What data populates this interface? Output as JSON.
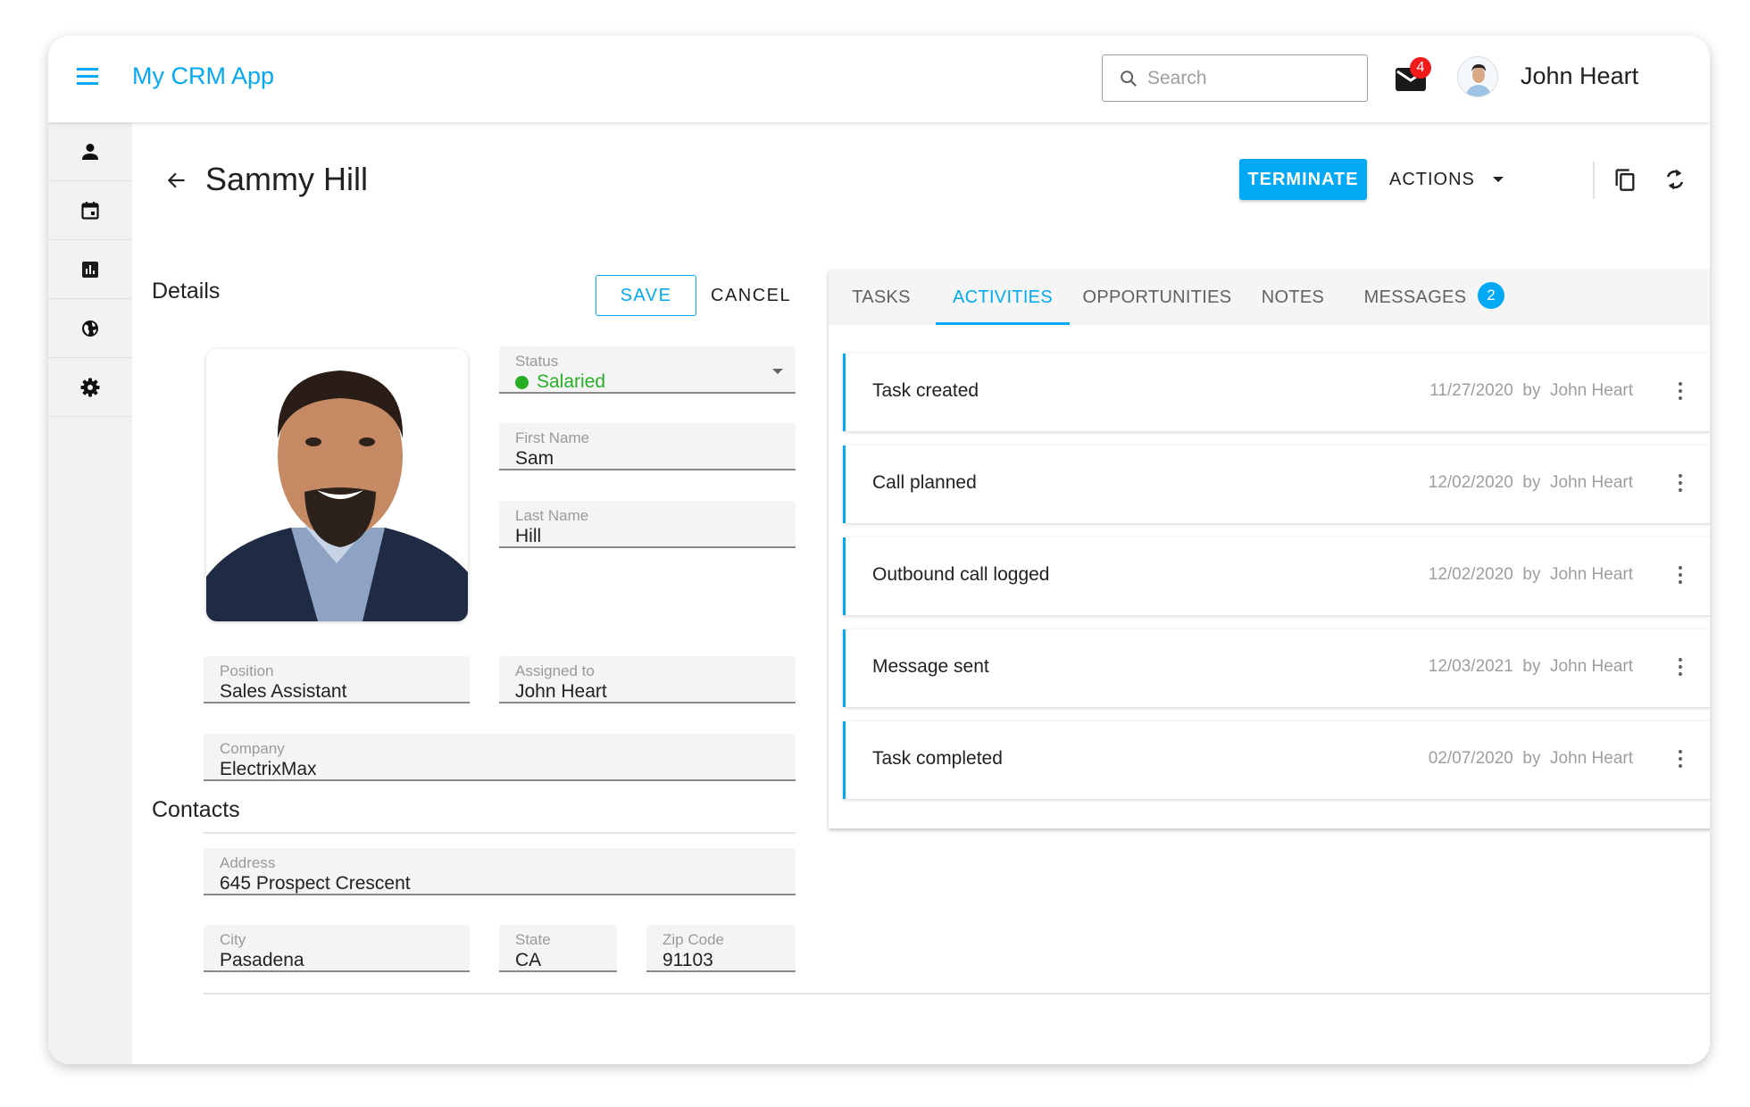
{
  "app": {
    "title": "My CRM App",
    "search_placeholder": "Search",
    "mail_badge_count": "4",
    "user_name": "John Heart",
    "accent_color": "#03a9f4"
  },
  "sidebar": {
    "items": [
      {
        "icon": "person-icon",
        "label": "Contacts"
      },
      {
        "icon": "calendar-icon",
        "label": "Calendar"
      },
      {
        "icon": "chart-icon",
        "label": "Analytics"
      },
      {
        "icon": "globe-icon",
        "label": "Globe"
      },
      {
        "icon": "gear-icon",
        "label": "Settings"
      }
    ]
  },
  "page": {
    "title": "Sammy Hill",
    "terminate_label": "TERMINATE",
    "actions_label": "ACTIONS"
  },
  "details": {
    "heading": "Details",
    "save_label": "SAVE",
    "cancel_label": "CANCEL",
    "status": {
      "label": "Status",
      "value": "Salaried",
      "color": "#27ae27"
    },
    "first_name": {
      "label": "First Name",
      "value": "Sam"
    },
    "last_name": {
      "label": "Last Name",
      "value": "Hill"
    },
    "position": {
      "label": "Position",
      "value": "Sales Assistant"
    },
    "assigned_to": {
      "label": "Assigned to",
      "value": "John Heart"
    },
    "company": {
      "label": "Company",
      "value": "ElectrixMax"
    }
  },
  "contacts": {
    "heading": "Contacts",
    "address": {
      "label": "Address",
      "value": "645 Prospect Crescent"
    },
    "city": {
      "label": "City",
      "value": "Pasadena"
    },
    "state": {
      "label": "State",
      "value": "CA"
    },
    "zip": {
      "label": "Zip Code",
      "value": "91103"
    }
  },
  "tabs": {
    "items": [
      {
        "label": "TASKS",
        "active": false
      },
      {
        "label": "ACTIVITIES",
        "active": true
      },
      {
        "label": "OPPORTUNITIES",
        "active": false
      },
      {
        "label": "NOTES",
        "active": false
      },
      {
        "label": "MESSAGES",
        "active": false
      }
    ],
    "messages_badge": "2"
  },
  "activities": [
    {
      "title": "Task created",
      "date": "11/27/2020",
      "by": "by",
      "author": "John Heart"
    },
    {
      "title": "Call planned",
      "date": "12/02/2020",
      "by": "by",
      "author": "John Heart"
    },
    {
      "title": "Outbound call logged",
      "date": "12/02/2020",
      "by": "by",
      "author": "John Heart"
    },
    {
      "title": "Message sent",
      "date": "12/03/2021",
      "by": "by",
      "author": "John Heart"
    },
    {
      "title": "Task completed",
      "date": "02/07/2020",
      "by": "by",
      "author": "John Heart"
    }
  ]
}
